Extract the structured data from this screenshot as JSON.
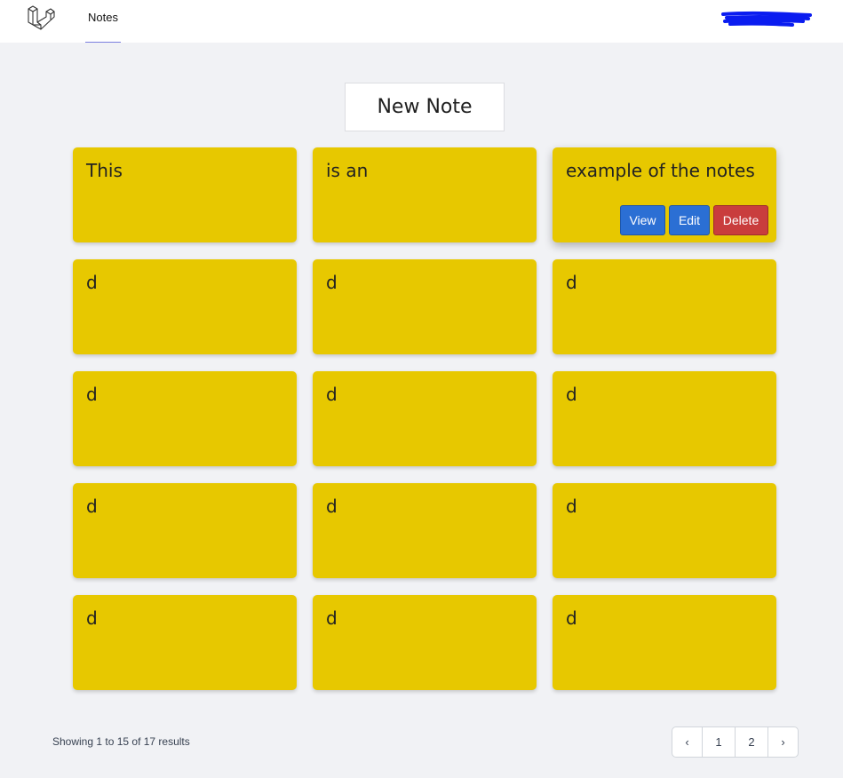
{
  "nav": {
    "notes_label": "Notes"
  },
  "new_note_label": "New Note",
  "notes": [
    {
      "text": "This"
    },
    {
      "text": "is an"
    },
    {
      "text": "example of the notes",
      "actions": {
        "view": "View",
        "edit": "Edit",
        "delete": "Delete"
      }
    },
    {
      "text": "d"
    },
    {
      "text": "d"
    },
    {
      "text": "d"
    },
    {
      "text": "d"
    },
    {
      "text": "d"
    },
    {
      "text": "d"
    },
    {
      "text": "d"
    },
    {
      "text": "d"
    },
    {
      "text": "d"
    },
    {
      "text": "d"
    },
    {
      "text": "d"
    },
    {
      "text": "d"
    }
  ],
  "pagination": {
    "summary": "Showing 1 to 15 of 17 results",
    "prev_icon": "‹",
    "pages": [
      "1",
      "2"
    ],
    "next_icon": "›"
  },
  "colors": {
    "note": "#e7c800",
    "view_button": "#2b6fd4",
    "edit_button": "#2b6fd4",
    "delete_button": "#c93d3d",
    "user_scribble": "#0a1cf0"
  },
  "icons": {
    "logo": "laravel-logo-icon",
    "prev": "chevron-left-icon",
    "next": "chevron-right-icon"
  }
}
